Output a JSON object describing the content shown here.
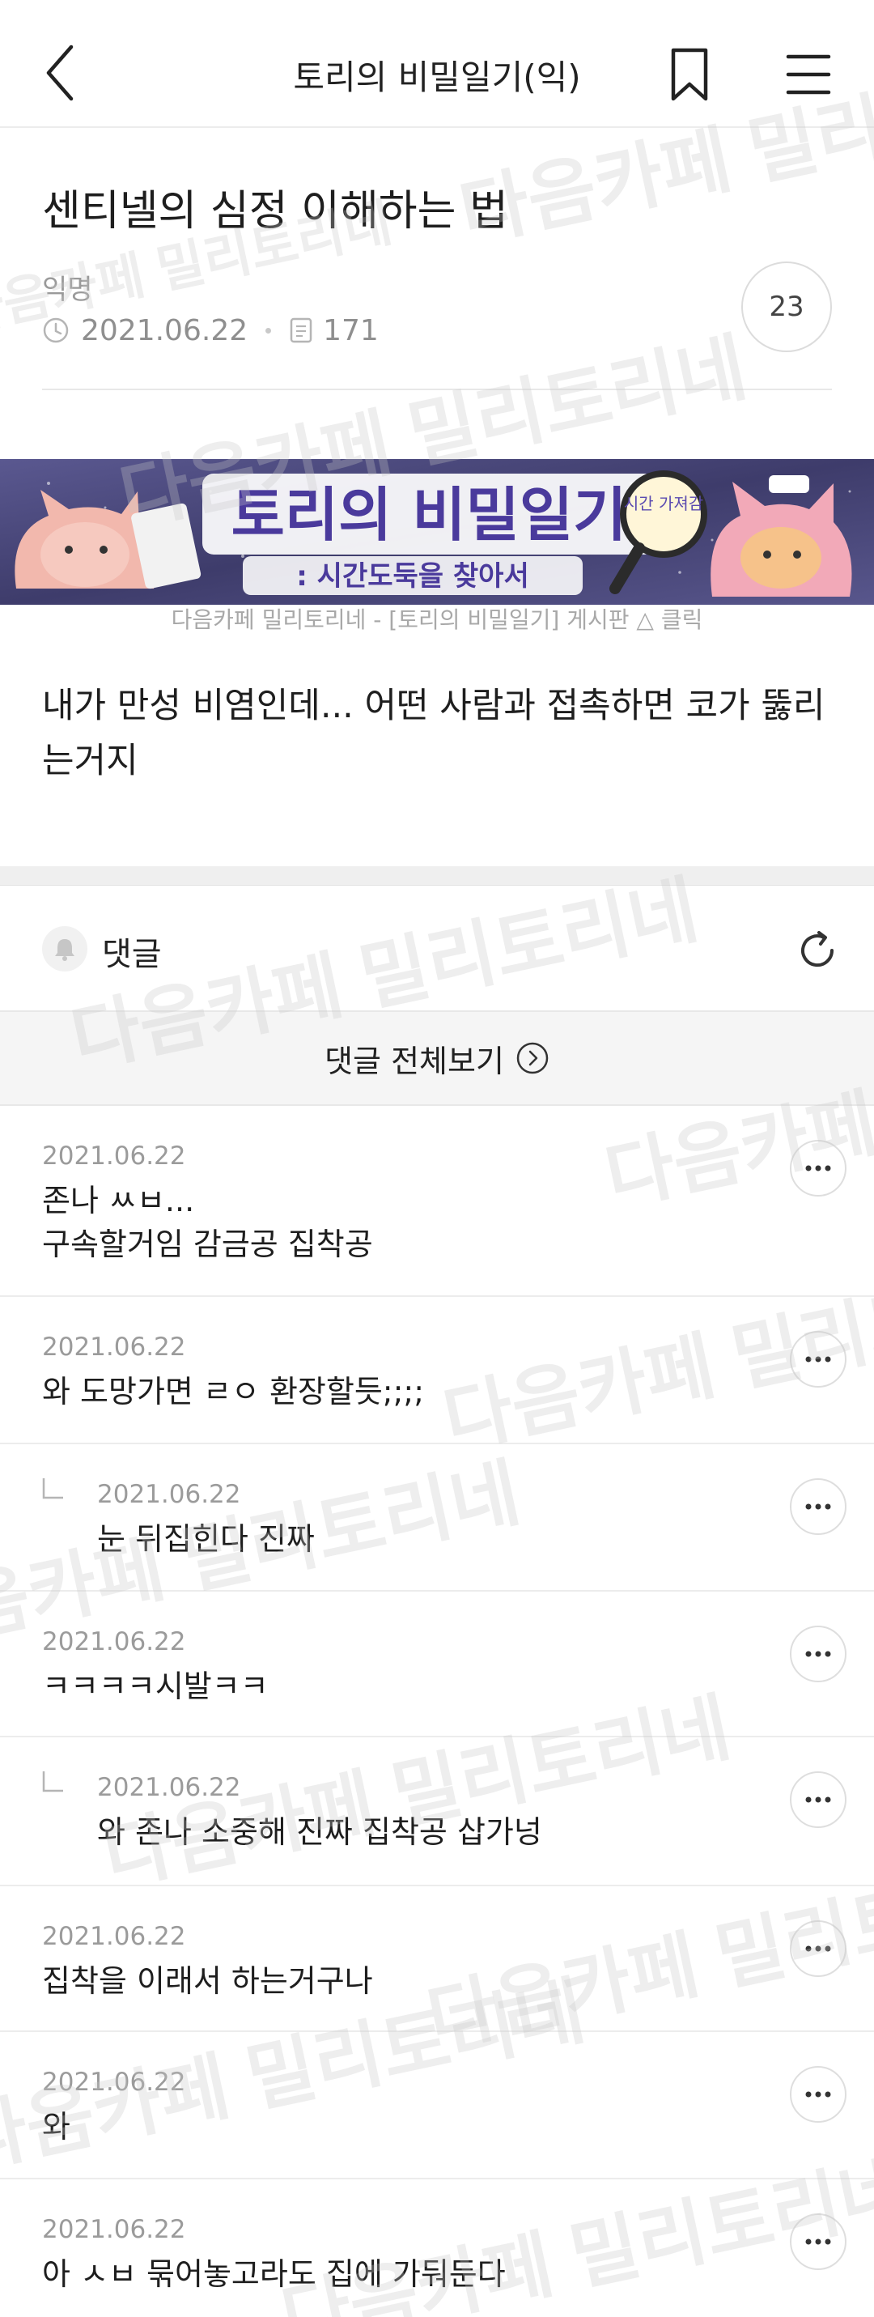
{
  "header": {
    "title": "토리의 비밀일기(익)",
    "back_icon": "chevron-left-icon",
    "bookmark_icon": "bookmark-icon",
    "menu_icon": "hamburger-menu-icon"
  },
  "post": {
    "title": "센티넬의 심정 이해하는 법",
    "author": "익명",
    "date": "2021.06.22",
    "views": "171",
    "comment_count": "23",
    "body": "내가 만성 비염인데... 어떤 사람과 접촉하면 코가 뚫리는거지"
  },
  "banner": {
    "title": "토리의 비밀일기",
    "subtitle": ": 시간도둑을 찾아서",
    "badge": "시간 가져감",
    "caption": "다음카페 밀리토리네 - [토리의 비밀일기] 게시판 △ 클릭"
  },
  "comments_section": {
    "label": "댓글",
    "view_all": "댓글 전체보기"
  },
  "comments": [
    {
      "date": "2021.06.22",
      "text": "존나 ㅆㅂ...\n구속할거임 감금공 집착공",
      "reply": false
    },
    {
      "date": "2021.06.22",
      "text": "와 도망가면 ㄹㅇ 환장할듯;;;;",
      "reply": false
    },
    {
      "date": "2021.06.22",
      "text": "눈 뒤집힌다 진짜",
      "reply": true
    },
    {
      "date": "2021.06.22",
      "text": "ㅋㅋㅋㅋ시발ㅋㅋ",
      "reply": false
    },
    {
      "date": "2021.06.22",
      "text": "와 존나 소중해 진짜 집착공 삽가넝",
      "reply": true
    },
    {
      "date": "2021.06.22",
      "text": "집착을 이래서 하는거구나",
      "reply": false
    },
    {
      "date": "2021.06.22",
      "text": "와",
      "reply": false
    },
    {
      "date": "2021.06.22",
      "text": "아 ㅅㅂ 묶어놓고라도 집에 가둬둔다",
      "reply": false
    }
  ],
  "watermark": "다음카페 밀리토리네",
  "colors": {
    "banner_bg": "#4c4a7a",
    "banner_title": "#4a3a9c",
    "divider": "#ececec",
    "meta_text": "#8f8f8f"
  }
}
